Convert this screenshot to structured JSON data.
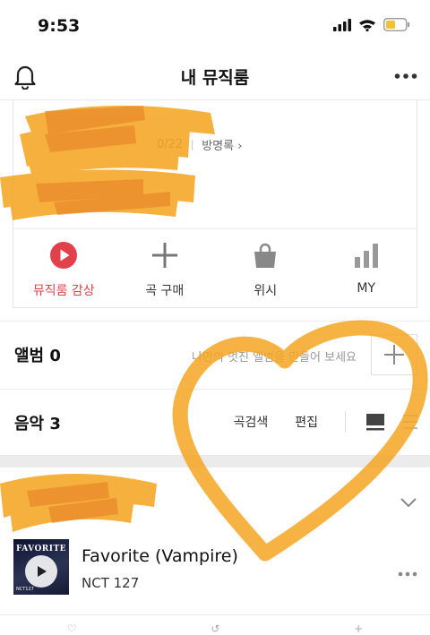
{
  "status_bar": {
    "time": "9:53"
  },
  "header": {
    "title": "내 뮤직룸"
  },
  "profile": {
    "count_partial": "0/22",
    "guestbook_label": "방명록",
    "guestbook_chevron": "›"
  },
  "quick_actions": [
    {
      "label": "뮤직룸 감상",
      "icon": "play-circle-icon"
    },
    {
      "label": "곡 구매",
      "icon": "plus-icon"
    },
    {
      "label": "위시",
      "icon": "shopping-bag-icon"
    },
    {
      "label": "MY",
      "icon": "bar-chart-icon"
    }
  ],
  "album_section": {
    "title": "앨범 0",
    "hint": "나만의 멋진 앨범을 만들어 보세요",
    "add_icon": "plus-icon"
  },
  "music_section": {
    "title": "음악 3",
    "search_label": "곡검색",
    "edit_label": "편집"
  },
  "song": {
    "title": "Favorite (Vampire)",
    "artist": "NCT 127",
    "art_title": "FAVORITE",
    "art_artist": "NCT127"
  },
  "colors": {
    "accent_red": "#e2404b",
    "icon_gray": "#888888",
    "scribble_orange": "#f5a623"
  }
}
